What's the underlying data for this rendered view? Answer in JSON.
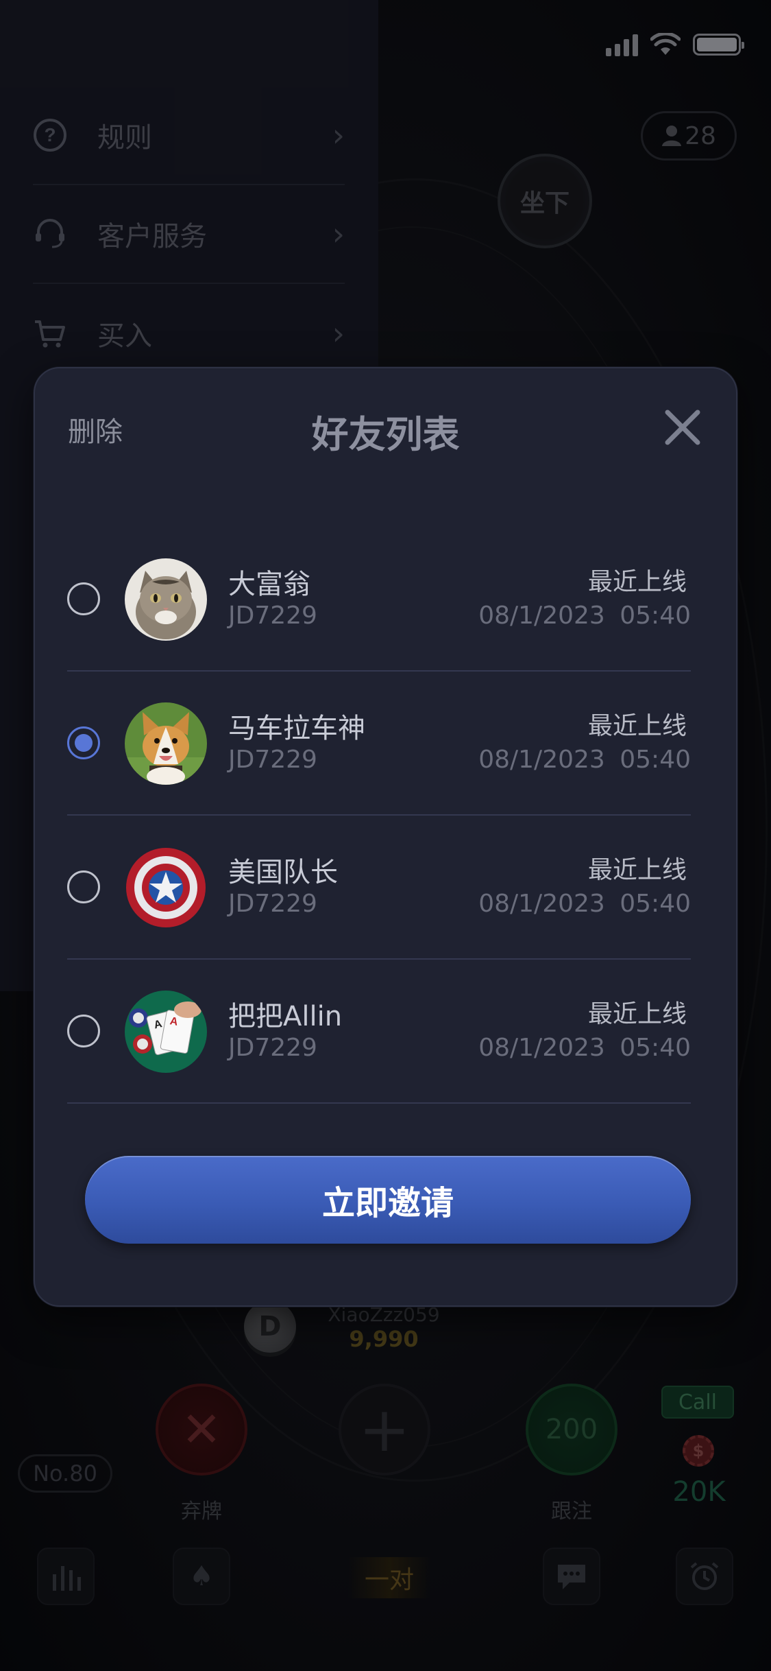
{
  "side_menu": {
    "items": [
      {
        "label": "规则",
        "icon": "question-circle-icon"
      },
      {
        "label": "客户服务",
        "icon": "headset-icon"
      },
      {
        "label": "买入",
        "icon": "cart-icon"
      }
    ]
  },
  "table": {
    "player_count": "28",
    "sit_label": "坐下",
    "dealer_label": "D",
    "me_name": "XiaoZzz059",
    "me_chips": "9,990",
    "fold_label": "弃牌",
    "call_label": "跟注",
    "call_amount": "200",
    "call_tag": "Call",
    "coin_symbol": "$",
    "call_total": "20K",
    "table_no": "No.80",
    "hand_label": "一对"
  },
  "modal": {
    "delete_label": "删除",
    "title": "好友列表",
    "invite_label": "立即邀请",
    "friends": [
      {
        "name": "大富翁",
        "id": "JD7229",
        "last_label": "最近上线",
        "last_time": "08/1/2023 05:40",
        "selected": false,
        "avatar": "cat-avatar"
      },
      {
        "name": "马车拉车神",
        "id": "JD7229",
        "last_label": "最近上线",
        "last_time": "08/1/2023 05:40",
        "selected": true,
        "avatar": "corgi-avatar"
      },
      {
        "name": "美国队长",
        "id": "JD7229",
        "last_label": "最近上线",
        "last_time": "08/1/2023 05:40",
        "selected": false,
        "avatar": "shield-avatar"
      },
      {
        "name": "把把Allin",
        "id": "JD7229",
        "last_label": "最近上线",
        "last_time": "08/1/2023 05:40",
        "selected": false,
        "avatar": "poker-cards-avatar"
      }
    ]
  },
  "colors": {
    "accent": "#5876d6",
    "modal_bg": "#1f2231",
    "invite_button": "#3a5bb5"
  }
}
